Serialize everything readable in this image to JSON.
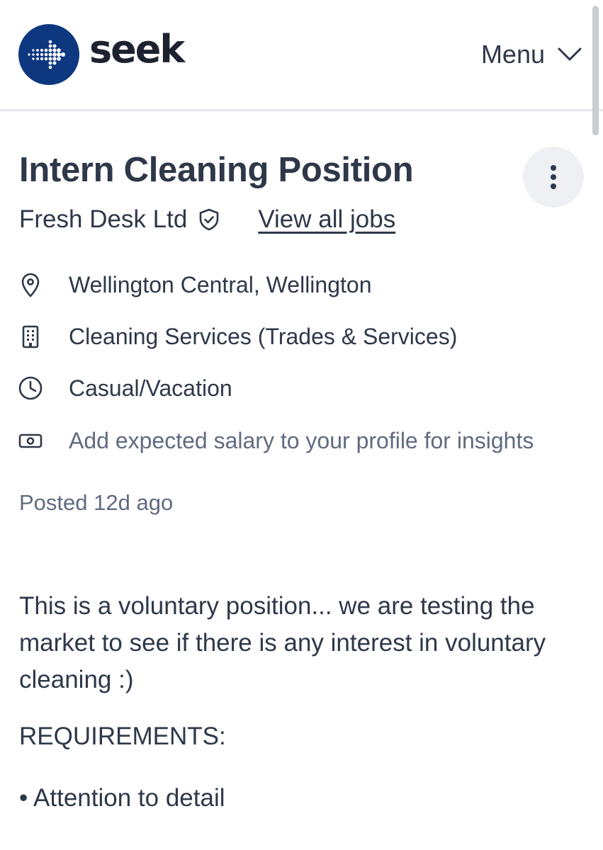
{
  "header": {
    "logo_text": "seek",
    "menu_label": "Menu"
  },
  "job": {
    "title": "Intern Cleaning Position",
    "company": "Fresh Desk Ltd",
    "view_all_jobs": "View all jobs",
    "location": "Wellington Central, Wellington",
    "category": "Cleaning Services (Trades & Services)",
    "work_type": "Casual/Vacation",
    "salary_prompt": "Add expected salary to your profile for insights",
    "posted": "Posted 12d ago"
  },
  "description": {
    "intro": "This is a voluntary position... we are testing the market to see if there is any interest in voluntary cleaning :)",
    "requirements_heading": "REQUIREMENTS:",
    "requirements": [
      "• Attention to detail"
    ]
  },
  "icons": {
    "logo": "seek-logo-icon",
    "menu": "chevron-down-icon",
    "more": "more-vertical-icon",
    "verified": "shield-check-icon",
    "location": "location-pin-icon",
    "category": "building-icon",
    "work_type": "clock-icon",
    "salary": "money-icon"
  },
  "colors": {
    "brand_blue": "#0d3880",
    "text": "#2e3849",
    "muted_text": "#5f6b80"
  }
}
